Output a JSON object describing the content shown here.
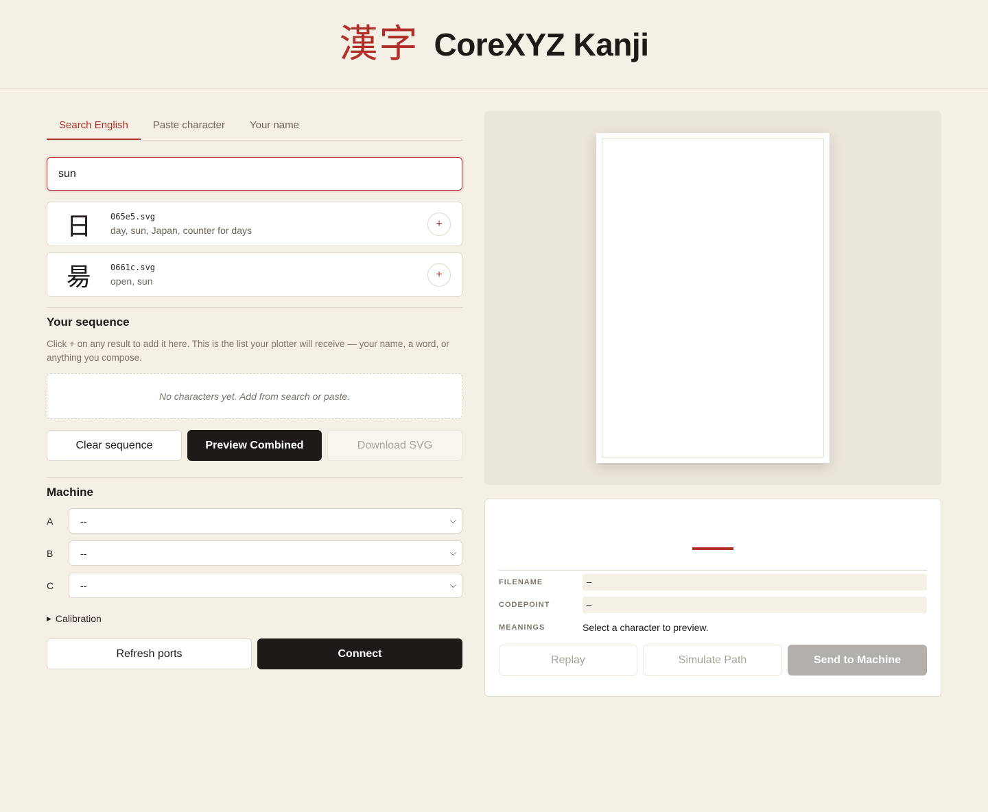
{
  "header": {
    "logo_text": "漢字",
    "title": "CoreXYZ Kanji"
  },
  "tabs": [
    {
      "label": "Search English",
      "active": true
    },
    {
      "label": "Paste character",
      "active": false
    },
    {
      "label": "Your name",
      "active": false
    }
  ],
  "search": {
    "value": "sun"
  },
  "results": [
    {
      "glyph": "日",
      "file": "065e5.svg",
      "meanings": "day, sun, Japan, counter for days",
      "add_label": "+"
    },
    {
      "glyph": "昜",
      "file": "0661c.svg",
      "meanings": "open, sun",
      "add_label": "+"
    }
  ],
  "sequence": {
    "title": "Your sequence",
    "help": "Click + on any result to add it here. This is the list your plotter will receive — your name, a word, or anything you compose.",
    "empty_text": "No characters yet. Add from search or paste.",
    "clear_label": "Clear sequence",
    "preview_label": "Preview Combined",
    "download_label": "Download SVG"
  },
  "machine": {
    "title": "Machine",
    "axes": [
      {
        "label": "A",
        "value": "--"
      },
      {
        "label": "B",
        "value": "--"
      },
      {
        "label": "C",
        "value": "--"
      }
    ],
    "calibration_label": "Calibration",
    "refresh_label": "Refresh ports",
    "connect_label": "Connect"
  },
  "info": {
    "filename_key": "FILENAME",
    "filename_value": "–",
    "codepoint_key": "CODEPOINT",
    "codepoint_value": "–",
    "meanings_key": "MEANINGS",
    "meanings_value": "Select a character to preview.",
    "replay_label": "Replay",
    "simulate_label": "Simulate Path",
    "send_label": "Send to Machine"
  },
  "colors": {
    "accent": "#b0312a",
    "background": "#f5f0e6",
    "dark": "#1f1a17",
    "send_disabled": "#b3b0ac"
  }
}
